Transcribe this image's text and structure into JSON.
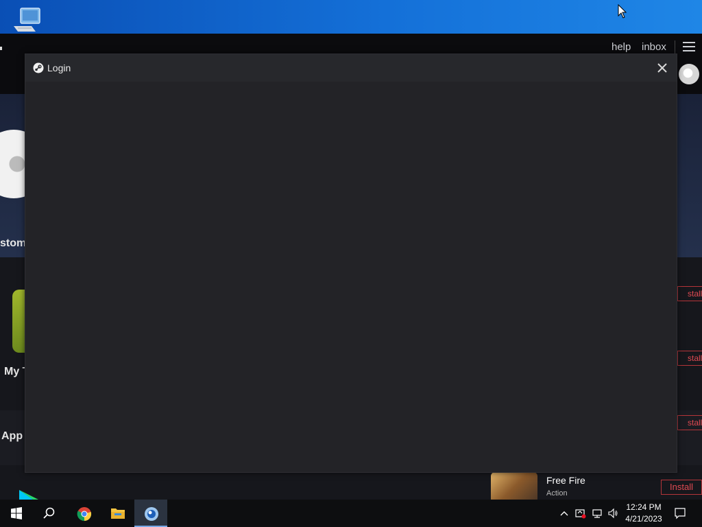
{
  "desktop": {
    "icon_name": "this-pc-icon"
  },
  "app": {
    "nav": {
      "help": "help",
      "inbox": "inbox"
    },
    "left_labels": [
      "stom",
      "My T",
      "App"
    ],
    "install_partial": [
      "stall",
      "stall",
      "stall"
    ],
    "game_row": {
      "name": "Free Fire",
      "genre": "Action",
      "install": "Install"
    }
  },
  "dialog": {
    "title": "Login",
    "close_icon": "close-icon"
  },
  "taskbar": {
    "items": [
      "start-icon",
      "search-icon",
      "chrome-icon",
      "file-explorer-icon",
      "app-icon"
    ],
    "clock": {
      "time": "12:24 PM",
      "date": "4/21/2023"
    }
  },
  "colors": {
    "accent": "#1f86e6",
    "install_red": "#e04a52",
    "dialog_bg": "#232327"
  }
}
